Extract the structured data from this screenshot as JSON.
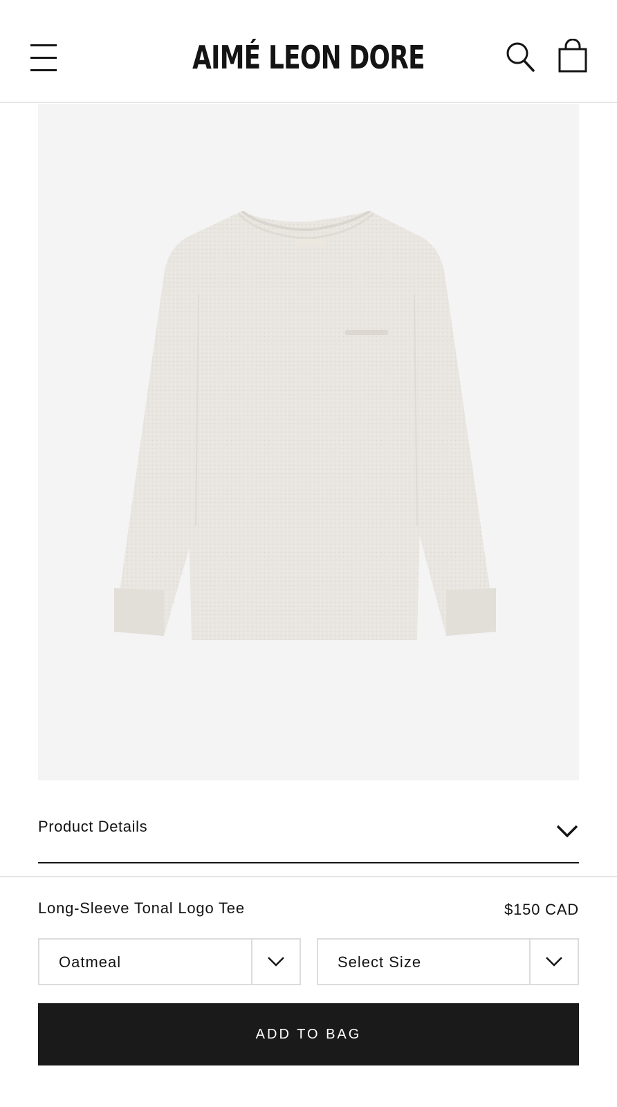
{
  "header": {
    "brand": "AIMÉ LEON DORE",
    "menu_icon": "hamburger-menu-icon",
    "search_icon": "search-icon",
    "bag_icon": "shopping-bag-icon"
  },
  "gallery": {
    "background_color": "#f4f4f4",
    "image_subject": "long-sleeve tee, oatmeal heather"
  },
  "details": {
    "label": "Product Details",
    "chevron_icon": "chevron-down-icon"
  },
  "product": {
    "name": "Long-Sleeve Tonal Logo Tee",
    "price": "$150 CAD"
  },
  "selectors": {
    "color": {
      "selected": "Oatmeal",
      "icon": "chevron-down-icon"
    },
    "size": {
      "selected": "Select Size",
      "icon": "chevron-down-icon"
    }
  },
  "cta": {
    "add_to_bag_label": "ADD TO BAG",
    "button_color": "#1a1a1a"
  }
}
